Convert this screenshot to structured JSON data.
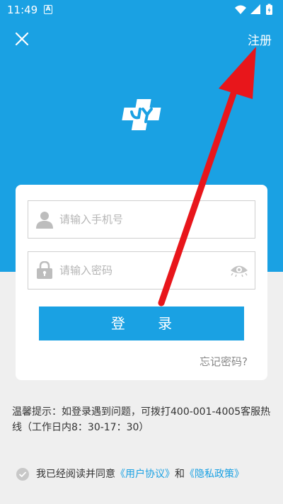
{
  "status_bar": {
    "time": "11:49",
    "notification_icon": "A"
  },
  "header": {
    "close_icon": "close-icon",
    "register_label": "注册"
  },
  "login_form": {
    "phone_placeholder": "请输入手机号",
    "password_placeholder": "请输入密码",
    "login_label": "登 录",
    "forgot_label": "忘记密码?"
  },
  "tips": {
    "text": "温馨提示：如登录遇到问题，可拨打400-001-4005客服热线（工作日内8：30-17：30）"
  },
  "agreement": {
    "prefix": "我已经阅读并同意",
    "user_agreement": "《用户协议》",
    "and": "和",
    "privacy_policy": "《隐私政策》"
  },
  "colors": {
    "primary": "#1aa1e3",
    "background": "#efefef",
    "arrow": "#e8161b"
  }
}
